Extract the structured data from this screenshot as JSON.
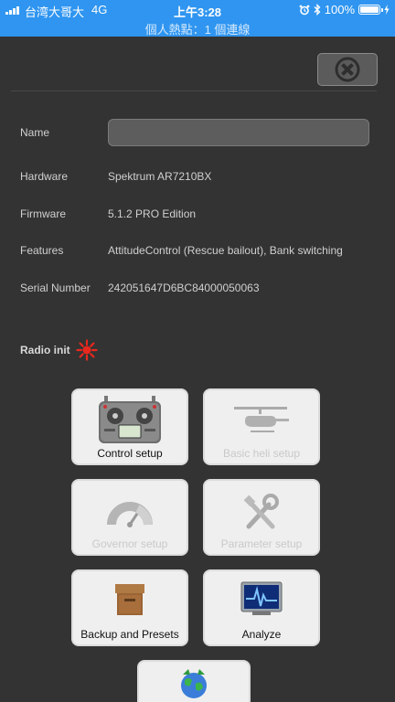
{
  "status_bar": {
    "carrier": "台湾大哥大",
    "network": "4G",
    "time": "上午3:28",
    "battery": "100%",
    "battery_level": 1.0,
    "hotspot_text": "個人熱點：1 個連線"
  },
  "device_info": {
    "name_label": "Name",
    "name_value": "",
    "hardware_label": "Hardware",
    "hardware_value": "Spektrum AR7210BX",
    "firmware_label": "Firmware",
    "firmware_value": "5.1.2 PRO Edition",
    "features_label": "Features",
    "features_value": "AttitudeControl (Rescue bailout), Bank switching",
    "serial_label": "Serial Number",
    "serial_value": "242051647D6BC84000050063"
  },
  "radio_init": {
    "label": "Radio init",
    "status_color": "#e8281e"
  },
  "menu": {
    "control_setup": "Control setup",
    "basic_heli_setup": "Basic heli setup",
    "governor_setup": "Governor setup",
    "parameter_setup": "Parameter setup",
    "backup_presets": "Backup and Presets",
    "analyze": "Analyze"
  },
  "colors": {
    "status_bar_bg": "#2f95f0",
    "background": "#333333",
    "tile_bg": "#efefef",
    "disabled_label": "#c9c9c9"
  }
}
